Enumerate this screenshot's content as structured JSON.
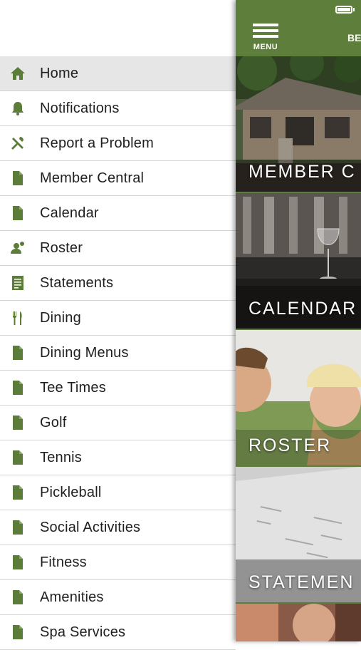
{
  "drawer": {
    "items": [
      {
        "label": "Home",
        "icon": "home-icon",
        "active": true
      },
      {
        "label": "Notifications",
        "icon": "bell-icon"
      },
      {
        "label": "Report a Problem",
        "icon": "tools-icon"
      },
      {
        "label": "Member Central",
        "icon": "document-icon"
      },
      {
        "label": "Calendar",
        "icon": "document-icon"
      },
      {
        "label": "Roster",
        "icon": "people-icon"
      },
      {
        "label": "Statements",
        "icon": "statement-icon"
      },
      {
        "label": "Dining",
        "icon": "fork-knife-icon"
      },
      {
        "label": "Dining Menus",
        "icon": "document-icon"
      },
      {
        "label": "Tee Times",
        "icon": "document-icon"
      },
      {
        "label": "Golf",
        "icon": "document-icon"
      },
      {
        "label": "Tennis",
        "icon": "document-icon"
      },
      {
        "label": "Pickleball",
        "icon": "document-icon"
      },
      {
        "label": "Social Activities",
        "icon": "document-icon"
      },
      {
        "label": "Fitness",
        "icon": "document-icon"
      },
      {
        "label": "Amenities",
        "icon": "document-icon"
      },
      {
        "label": "Spa Services",
        "icon": "document-icon"
      }
    ]
  },
  "header": {
    "menu_label": "MENU",
    "title_partial": "BE"
  },
  "tiles": [
    {
      "label": "MEMBER C"
    },
    {
      "label": "CALENDAR"
    },
    {
      "label": "ROSTER"
    },
    {
      "label": "STATEMEN"
    }
  ],
  "colors": {
    "accent": "#5e7e3c",
    "icon": "#5c7d3a",
    "active_row": "#e6e6e6",
    "divider": "#d4d4d4"
  }
}
